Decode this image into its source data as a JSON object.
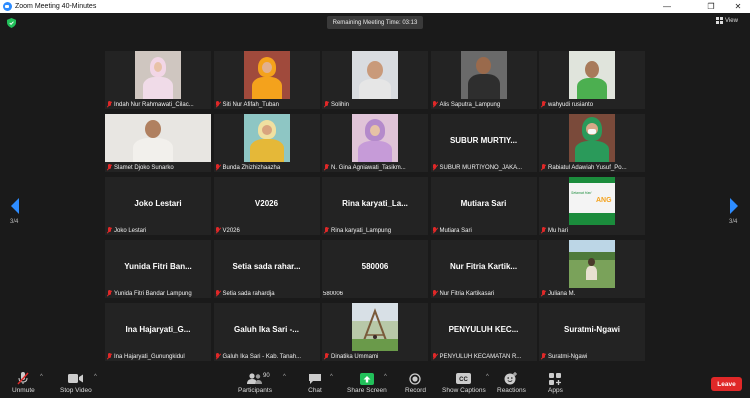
{
  "window": {
    "title": "Zoom Meeting 40-Minutes"
  },
  "topbar": {
    "timer": "Remaining Meeting Time: 03:13",
    "view_label": "View"
  },
  "nav": {
    "page_left": "3/4",
    "page_right": "3/4"
  },
  "tiles": [
    {
      "label": "Indah Nur Rahmawati_Cilac..."
    },
    {
      "label": "Siti Nur Afifah_Tuban"
    },
    {
      "label": "Solihin"
    },
    {
      "label": "Alis Saputra_Lampung"
    },
    {
      "label": "wahyudi rusianto"
    },
    {
      "label": "Slamet Djoko Sunarko"
    },
    {
      "label": "Bunda Zhizhizhaazha"
    },
    {
      "label": "N. Gina Agniawati_Tasikm..."
    },
    {
      "big": "SUBUR MURTIY...",
      "label": "SUBUR MURTIYONO_JAKA..."
    },
    {
      "label": "Rabiatul Adawiah Yusuf_Po..."
    },
    {
      "big": "Joko Lestari",
      "label": "Joko Lestari"
    },
    {
      "big": "V2026",
      "label": "V2026"
    },
    {
      "big": "Rina karyati_La...",
      "label": "Rina karyati_Lampung"
    },
    {
      "big": "Mutiara Sari",
      "label": "Mutiara Sari"
    },
    {
      "label": "Mu hari",
      "image_text": "ANG",
      "image_small": "Selamat Hari"
    },
    {
      "big": "Yunida Fitri Ban...",
      "label": "Yunida Fitri Bandar Lampung"
    },
    {
      "big": "Setia sada rahar...",
      "label": "Setia sada rahardja"
    },
    {
      "big": "580006",
      "label": "580006"
    },
    {
      "big": "Nur Fitria Kartik...",
      "label": "Nur Fitria Kartikasari"
    },
    {
      "label": "Juliana M."
    },
    {
      "big": "Ina Hajaryati_G...",
      "label": "Ina Hajaryati_Gunungkidul"
    },
    {
      "big": "Galuh Ika Sari -...",
      "label": "Galuh Ika Sari - Kab. Tanah..."
    },
    {
      "label": "Dinatika Ummami"
    },
    {
      "big": "PENYULUH KEC...",
      "label": "PENYULUH KECAMATAN R..."
    },
    {
      "big": "Suratmi-Ngawi",
      "label": "Suratmi-Ngawi"
    }
  ],
  "toolbar": {
    "unmute": "Unmute",
    "stop_video": "Stop Video",
    "participants": "Participants",
    "participants_count": "90",
    "chat": "Chat",
    "share_screen": "Share Screen",
    "record": "Record",
    "show_captions": "Show Captions",
    "reactions": "Reactions",
    "apps": "Apps",
    "leave": "Leave"
  },
  "colors": {
    "share_green": "#22c05a",
    "leave_red": "#e02828",
    "mute_red": "#e02828",
    "zoom_blue": "#2d8cff"
  }
}
